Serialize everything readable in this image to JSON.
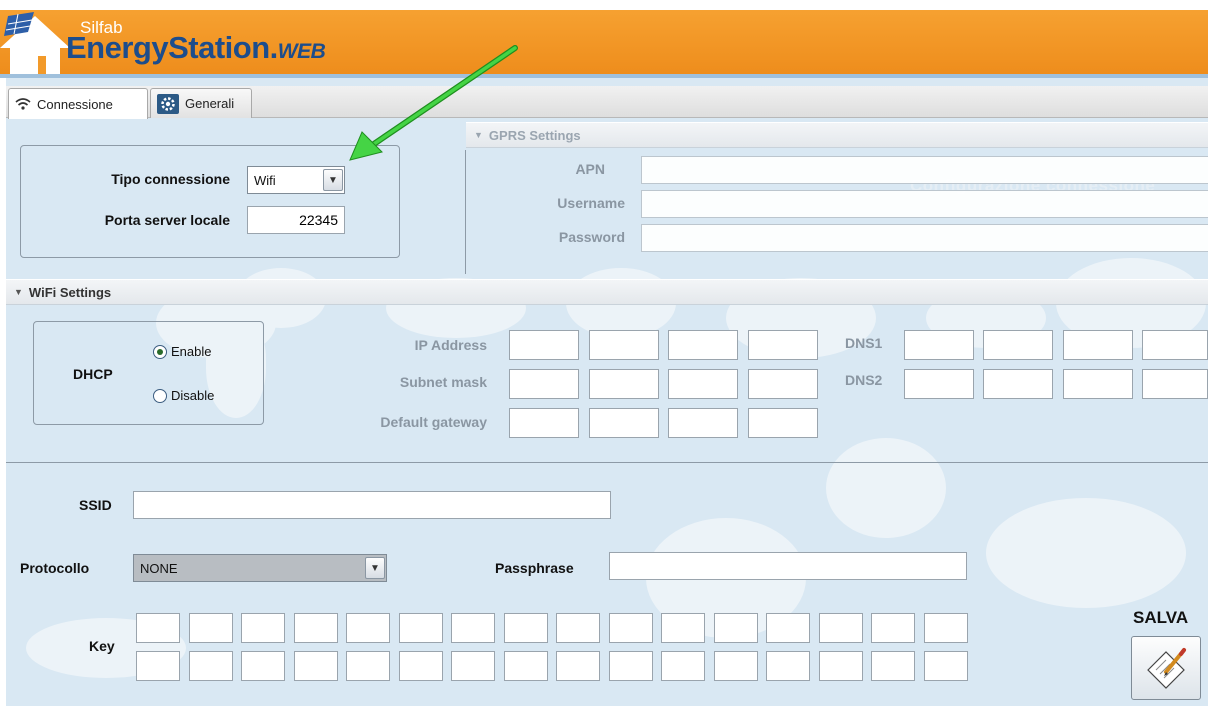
{
  "header": {
    "brand_small": "Silfab",
    "brand_main": "EnergyStation.",
    "brand_suffix": "WEB"
  },
  "tabs": [
    {
      "label": "Connessione",
      "icon": "wifi-icon",
      "active": true
    },
    {
      "label": "Generali",
      "icon": "gear-icon",
      "active": false
    }
  ],
  "connection": {
    "tipo_label": "Tipo connessione",
    "tipo_value": "Wifi",
    "porta_label": "Porta server locale",
    "porta_value": "22345"
  },
  "gprs": {
    "title": "GPRS Settings",
    "apn_label": "APN",
    "username_label": "Username",
    "password_label": "Password",
    "watermark": "Configurazione connessione"
  },
  "wifi": {
    "title": "WiFi Settings",
    "dhcp_label": "DHCP",
    "enable_label": "Enable",
    "disable_label": "Disable",
    "dhcp_selected": "Enable",
    "ip_label": "IP Address",
    "subnet_label": "Subnet mask",
    "gateway_label": "Default gateway",
    "dns1_label": "DNS1",
    "dns2_label": "DNS2",
    "ssid_label": "SSID",
    "ssid_value": "",
    "protocollo_label": "Protocollo",
    "protocollo_value": "NONE",
    "passphrase_label": "Passphrase",
    "passphrase_value": "",
    "key_label": "Key"
  },
  "save": {
    "label": "SALVA"
  },
  "colors": {
    "header_orange": "#f29a2a",
    "brand_blue": "#1d4d8c",
    "background_blue": "#d9e8f3",
    "annotation_arrow": "#35c635"
  }
}
